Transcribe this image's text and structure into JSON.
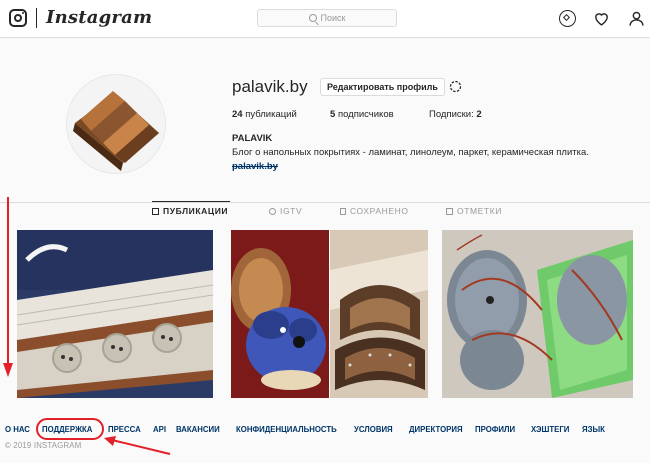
{
  "header": {
    "wordmark": "Instagram",
    "search_placeholder": "Поиск"
  },
  "profile": {
    "username": "palavik.by",
    "edit_button": "Редактировать профиль",
    "stats": {
      "posts_count": "24",
      "posts_label": "публикаций",
      "followers_count": "5",
      "followers_label": "подписчиков",
      "following_label": "Подписки:",
      "following_count": "2"
    },
    "full_name": "PALAVIK",
    "bio": "Блог о напольных покрытиях - ламинат, линолеум, паркет, керамическая плитка.",
    "website": "palavik.by"
  },
  "tabs": [
    {
      "label": "ПУБЛИКАЦИИ",
      "icon": "grid-icon",
      "active": true
    },
    {
      "label": "IGTV",
      "icon": "igtv-icon",
      "active": false
    },
    {
      "label": "СОХРАНЕНО",
      "icon": "bookmark-icon",
      "active": false
    },
    {
      "label": "ОТМЕТКИ",
      "icon": "tag-icon",
      "active": false
    }
  ],
  "footer": {
    "links": [
      "О НАС",
      "ПОДДЕРЖКА",
      "ПРЕССА",
      "API",
      "ВАКАНСИИ",
      "КОНФИДЕНЦИАЛЬНОСТЬ",
      "УСЛОВИЯ",
      "ДИРЕКТОРИЯ",
      "ПРОФИЛИ",
      "ХЭШТЕГИ",
      "ЯЗЫК"
    ],
    "copyright": "© 2019 INSTAGRAM"
  },
  "colors": {
    "annotation": "#e3202a",
    "link": "#003569",
    "muted": "#999999"
  }
}
